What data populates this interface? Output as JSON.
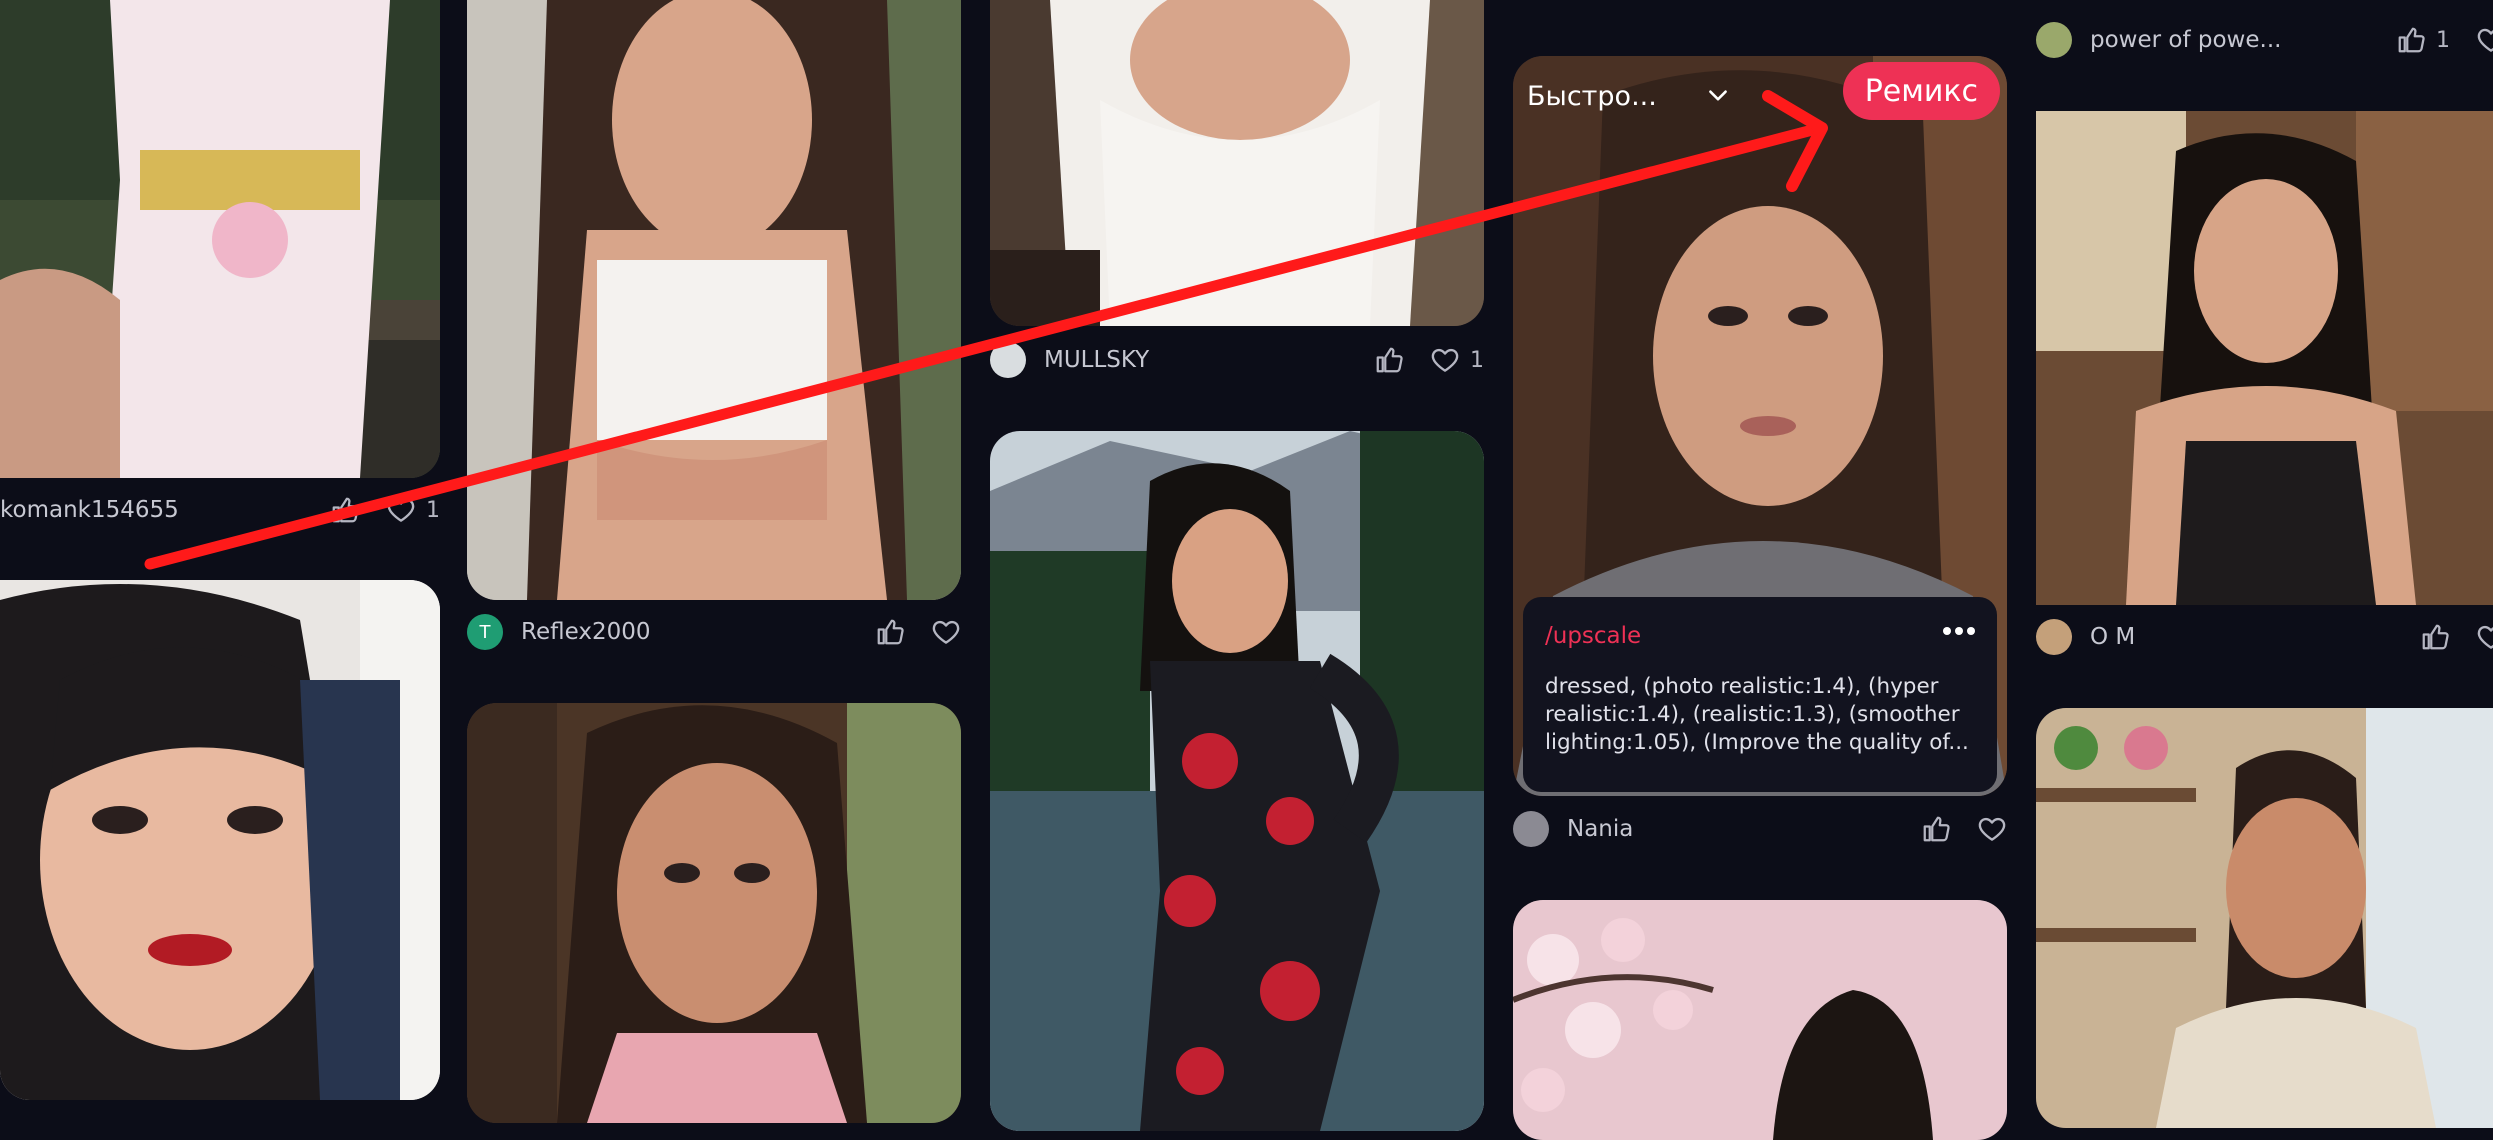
{
  "feed": {
    "cards": [
      {
        "id": "c1",
        "author": "komank154655",
        "likes": "",
        "hearts": "1"
      },
      {
        "id": "c2",
        "author": "Reflex2000",
        "avatar_letter": "T",
        "likes": "",
        "hearts": ""
      },
      {
        "id": "c3",
        "author": "MULLSKY",
        "likes": "",
        "hearts": "1"
      },
      {
        "id": "c4",
        "author": "Nania",
        "likes": "",
        "hearts": ""
      },
      {
        "id": "c5",
        "author": "power of powe...",
        "likes": "1",
        "hearts": ""
      },
      {
        "id": "c6",
        "author": "O M",
        "likes": "",
        "hearts": ""
      }
    ]
  },
  "highlight_card": {
    "sort_label": "Быстро...",
    "remix_label": "Ремикс",
    "prompt_command": "/upscale",
    "prompt_text": "dressed, (photo realistic:1.4), (hyper realistic:1.4), (realistic:1.3), (smoother lighting:1.05), (Improve the quality of..."
  },
  "colors": {
    "background": "#0c0d18",
    "accent": "#ee3155",
    "annotation_arrow": "#ff1a1a"
  },
  "icons": {
    "like": "thumbs-up-icon",
    "heart": "heart-icon",
    "chevron": "chevron-down-icon",
    "more": "more-dots-icon"
  }
}
